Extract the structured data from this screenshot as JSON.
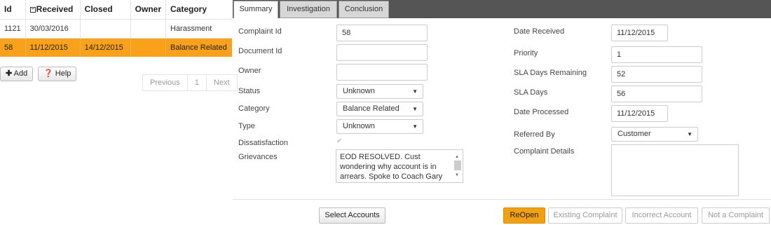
{
  "grid": {
    "headers": {
      "id": "Id",
      "received": "Received",
      "closed": "Closed",
      "owner": "Owner",
      "category": "Category"
    },
    "rows": [
      {
        "id": "1121",
        "received": "30/03/2016",
        "closed": "",
        "owner": "",
        "category": "Harassment"
      },
      {
        "id": "58",
        "received": "11/12/2015",
        "closed": "14/12/2015",
        "owner": "",
        "category": "Balance Related"
      }
    ]
  },
  "actions": {
    "add": "Add",
    "help": "Help"
  },
  "pager": {
    "previous": "Previous",
    "page": "1",
    "next": "Next"
  },
  "tabs": {
    "summary": "Summary",
    "investigation": "Investigation",
    "conclusion": "Conclusion"
  },
  "form": {
    "complaint_id": {
      "label": "Complaint Id",
      "value": "58"
    },
    "document_id": {
      "label": "Document Id",
      "value": ""
    },
    "owner": {
      "label": "Owner",
      "value": ""
    },
    "status": {
      "label": "Status",
      "value": "Unknown"
    },
    "category": {
      "label": "Category",
      "value": "Balance Related"
    },
    "type": {
      "label": "Type",
      "value": "Unknown"
    },
    "dissatisfaction": {
      "label": "Dissatisfaction",
      "checked": true
    },
    "grievances": {
      "label": "Grievances",
      "value": "EOD RESOLVED. Cust wondering why account is in arrears. Spoke to Coach Gary who adv accounts"
    },
    "date_received": {
      "label": "Date Received",
      "value": "11/12/2015"
    },
    "priority": {
      "label": "Priority",
      "value": "1"
    },
    "sla_days_remaining": {
      "label": "SLA Days Remaining",
      "value": "52"
    },
    "sla_days": {
      "label": "SLA Days",
      "value": "56"
    },
    "date_processed": {
      "label": "Date Processed",
      "value": "11/12/2015"
    },
    "referred_by": {
      "label": "Referred By",
      "value": "Customer"
    },
    "complaint_details": {
      "label": "Complaint Details",
      "value": ""
    }
  },
  "buttons": {
    "select_accounts": "Select Accounts",
    "reopen": "ReOpen",
    "existing_complaint": "Existing Complaint",
    "incorrect_account": "Incorrect Account",
    "not_a_complaint": "Not a Complaint"
  },
  "colors": {
    "selected_row": "#f9a11b",
    "primary_button": "#f0a013",
    "tab_bar": "#555555"
  }
}
